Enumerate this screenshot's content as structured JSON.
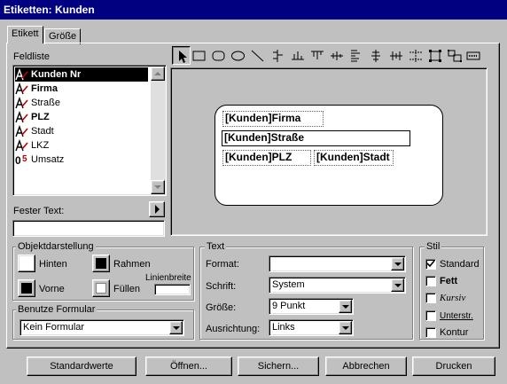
{
  "window": {
    "title": "Etiketten: Kunden"
  },
  "tabs": [
    {
      "label": "Etikett",
      "active": true
    },
    {
      "label": "Größe",
      "active": false
    }
  ],
  "feldliste": {
    "label": "Feldliste",
    "items": [
      {
        "label": "Kunden Nr",
        "icon": "text-field-icon",
        "bold": true,
        "selected": true
      },
      {
        "label": "Firma",
        "icon": "text-field-icon",
        "bold": true,
        "selected": false
      },
      {
        "label": "Straße",
        "icon": "text-field-icon",
        "bold": false,
        "selected": false
      },
      {
        "label": "PLZ",
        "icon": "text-field-icon",
        "bold": true,
        "selected": false
      },
      {
        "label": "Stadt",
        "icon": "text-field-icon",
        "bold": false,
        "selected": false
      },
      {
        "label": "LKZ",
        "icon": "text-field-icon",
        "bold": false,
        "selected": false
      },
      {
        "label": "Umsatz",
        "icon": "numeric-field-icon",
        "bold": false,
        "selected": false
      }
    ]
  },
  "fester_text": {
    "label": "Fester Text:",
    "value": ""
  },
  "toolbar": {
    "tools": [
      "pointer-tool-icon",
      "rectangle-tool-icon",
      "rounded-rectangle-tool-icon",
      "oval-tool-icon",
      "line-tool-icon",
      "align-left-icon",
      "align-center-horizontal-icon",
      "align-right-icon",
      "align-top-icon",
      "align-center-vertical-icon",
      "align-bottom-icon",
      "distribute-horizontal-icon",
      "distribute-vertical-icon",
      "same-size-icon",
      "group-icon",
      "text-tool-icon"
    ]
  },
  "label_preview": {
    "fields": [
      "[Kunden]Firma",
      "[Kunden]Straße",
      "[Kunden]PLZ",
      "[Kunden]Stadt"
    ]
  },
  "objektdarstellung": {
    "label": "Objektdarstellung",
    "hinten": "Hinten",
    "vorne": "Vorne",
    "rahmen": "Rahmen",
    "fuellen": "Füllen",
    "linienbreite": "Linienbreite",
    "linienbreite_value": ""
  },
  "benutze_formular": {
    "label": "Benutze Formular",
    "value": "Kein Formular"
  },
  "text_group": {
    "label": "Text",
    "format_label": "Format:",
    "format_value": "",
    "schrift_label": "Schrift:",
    "schrift_value": "System",
    "groesse_label": "Größe:",
    "groesse_value": "9 Punkt",
    "ausrichtung_label": "Ausrichtung:",
    "ausrichtung_value": "Links"
  },
  "stil": {
    "label": "Stil",
    "options": [
      {
        "label": "Standard",
        "checked": true
      },
      {
        "label": "Fett",
        "checked": false
      },
      {
        "label": "Kursiv",
        "checked": false
      },
      {
        "label": "Unterstr.",
        "checked": false
      },
      {
        "label": "Kontur",
        "checked": false
      }
    ]
  },
  "buttons": {
    "standardwerte": "Standardwerte",
    "oeffnen": "Öffnen...",
    "sichern": "Sichern...",
    "abbrechen": "Abbrechen",
    "drucken": "Drucken"
  },
  "colors": {
    "titlebar": "#000080",
    "selection": "#000000",
    "face": "#c0c0c0"
  }
}
